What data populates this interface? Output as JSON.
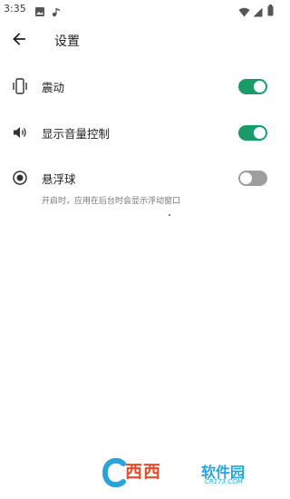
{
  "status_bar": {
    "time": "3:35",
    "left_icons": [
      "image-icon",
      "music-note-icon"
    ],
    "right_icons": [
      "wifi-icon",
      "signal-icon",
      "battery-icon"
    ]
  },
  "toolbar": {
    "back_icon": "arrow-left-icon",
    "title": "设置"
  },
  "settings": {
    "vibration": {
      "label": "震动",
      "icon": "phone-vibrate-icon",
      "enabled": true
    },
    "volume_control": {
      "label": "显示音量控制",
      "icon": "speaker-icon",
      "enabled": true
    },
    "floating_ball": {
      "label": "悬浮球",
      "icon": "radio-dot-icon",
      "enabled": false,
      "description": "开启时，应用在后台时会显示浮动窗口"
    }
  },
  "colors": {
    "switch_on": "#1b9a6a",
    "switch_off": "#9e9e9e"
  },
  "watermark": {
    "text": "西西",
    "text2": "软件园",
    "url": "CR173.COM"
  }
}
